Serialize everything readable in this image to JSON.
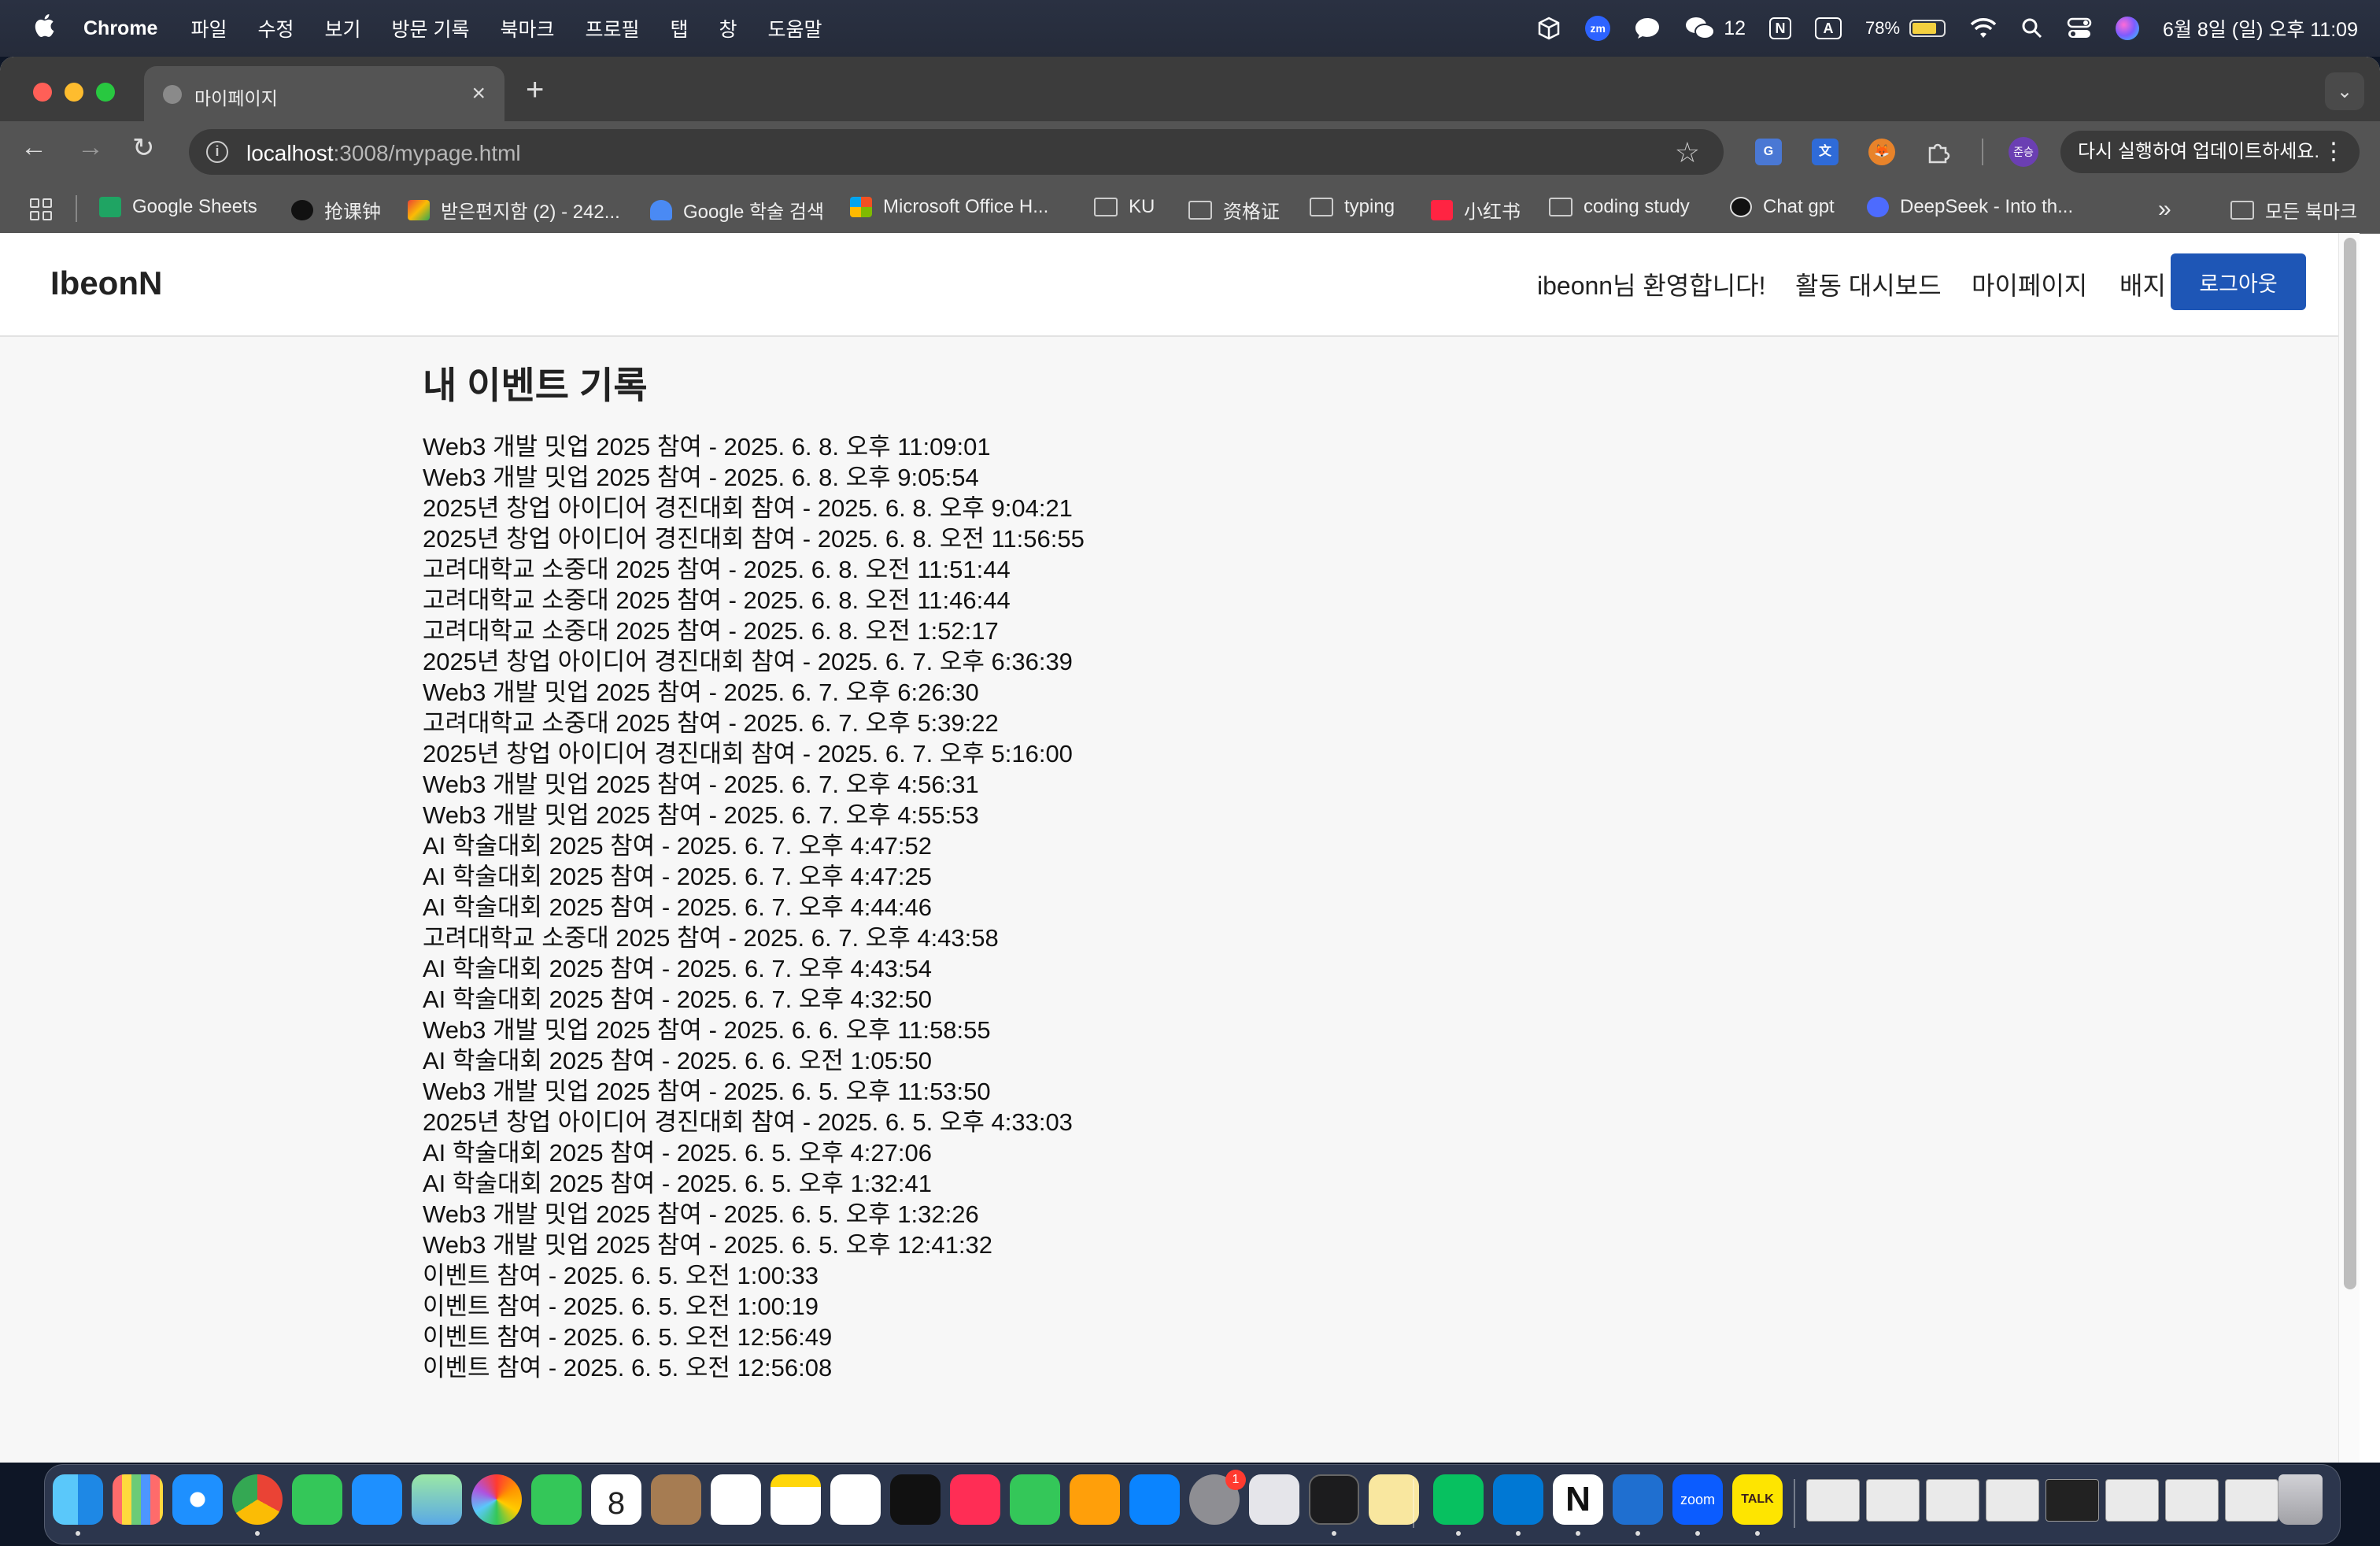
{
  "menubar": {
    "app_name": "Chrome",
    "menus": [
      "파일",
      "수정",
      "보기",
      "방문 기록",
      "북마크",
      "프로필",
      "탭",
      "창",
      "도움말"
    ],
    "wechat_count": "12",
    "input_letter": "A",
    "notion_letter": "N",
    "zoom_label": "zm",
    "battery_percent": "78%",
    "datetime": "6월 8일 (일) 오후 11:09"
  },
  "browser": {
    "tab_title": "마이페이지",
    "address_host": "localhost",
    "address_path": ":3008/mypage.html",
    "profile_initials": "준승",
    "update_label": "다시 실행하여 업데이트하세요.",
    "bookmarks": [
      "Google Sheets",
      "抢课钟",
      "받은편지함 (2) - 242...",
      "Google 학술 검색",
      "Microsoft Office H...",
      "KU",
      "资格证",
      "typing",
      "小红书",
      "coding study",
      "Chat gpt",
      "DeepSeek - Into th..."
    ],
    "all_bookmarks_label": "모든 북마크"
  },
  "site": {
    "logo": "IbeonN",
    "welcome": "ibeonn님 환영합니다!",
    "nav_dashboard": "활동 대시보드",
    "nav_mypage": "마이페이지",
    "nav_badge": "배지",
    "logout_label": "로그아웃"
  },
  "main": {
    "heading": "내 이벤트 기록",
    "events": [
      "Web3 개발 밋업 2025 참여 - 2025. 6. 8. 오후 11:09:01",
      "Web3 개발 밋업 2025 참여 - 2025. 6. 8. 오후 9:05:54",
      "2025년 창업 아이디어 경진대회 참여 - 2025. 6. 8. 오후 9:04:21",
      "2025년 창업 아이디어 경진대회 참여 - 2025. 6. 8. 오전 11:56:55",
      "고려대학교 소중대 2025 참여 - 2025. 6. 8. 오전 11:51:44",
      "고려대학교 소중대 2025 참여 - 2025. 6. 8. 오전 11:46:44",
      "고려대학교 소중대 2025 참여 - 2025. 6. 8. 오전 1:52:17",
      "2025년 창업 아이디어 경진대회 참여 - 2025. 6. 7. 오후 6:36:39",
      "Web3 개발 밋업 2025 참여 - 2025. 6. 7. 오후 6:26:30",
      "고려대학교 소중대 2025 참여 - 2025. 6. 7. 오후 5:39:22",
      "2025년 창업 아이디어 경진대회 참여 - 2025. 6. 7. 오후 5:16:00",
      "Web3 개발 밋업 2025 참여 - 2025. 6. 7. 오후 4:56:31",
      "Web3 개발 밋업 2025 참여 - 2025. 6. 7. 오후 4:55:53",
      "AI 학술대회 2025 참여 - 2025. 6. 7. 오후 4:47:52",
      "AI 학술대회 2025 참여 - 2025. 6. 7. 오후 4:47:25",
      "AI 학술대회 2025 참여 - 2025. 6. 7. 오후 4:44:46",
      "고려대학교 소중대 2025 참여 - 2025. 6. 7. 오후 4:43:58",
      "AI 학술대회 2025 참여 - 2025. 6. 7. 오후 4:43:54",
      "AI 학술대회 2025 참여 - 2025. 6. 7. 오후 4:32:50",
      "Web3 개발 밋업 2025 참여 - 2025. 6. 6. 오후 11:58:55",
      "AI 학술대회 2025 참여 - 2025. 6. 6. 오전 1:05:50",
      "Web3 개발 밋업 2025 참여 - 2025. 6. 5. 오후 11:53:50",
      "2025년 창업 아이디어 경진대회 참여 - 2025. 6. 5. 오후 4:33:03",
      "AI 학술대회 2025 참여 - 2025. 6. 5. 오후 4:27:06",
      "AI 학술대회 2025 참여 - 2025. 6. 5. 오후 1:32:41",
      "Web3 개발 밋업 2025 참여 - 2025. 6. 5. 오후 1:32:26",
      "Web3 개발 밋업 2025 참여 - 2025. 6. 5. 오후 12:41:32",
      "이벤트 참여 - 2025. 6. 5. 오전 1:00:33",
      "이벤트 참여 - 2025. 6. 5. 오전 1:00:19",
      "이벤트 참여 - 2025. 6. 5. 오전 12:56:49",
      "이벤트 참여 - 2025. 6. 5. 오전 12:56:08"
    ]
  },
  "dock": {
    "calendar_day": "8",
    "settings_badge": "1",
    "zoom_label": "zoom",
    "talk_label": "TALK",
    "notion_letter": "N"
  },
  "colors": {
    "accent": "#1e56b6",
    "page_bg": "#f7f7f7",
    "chrome_toolbar": "#545454"
  }
}
